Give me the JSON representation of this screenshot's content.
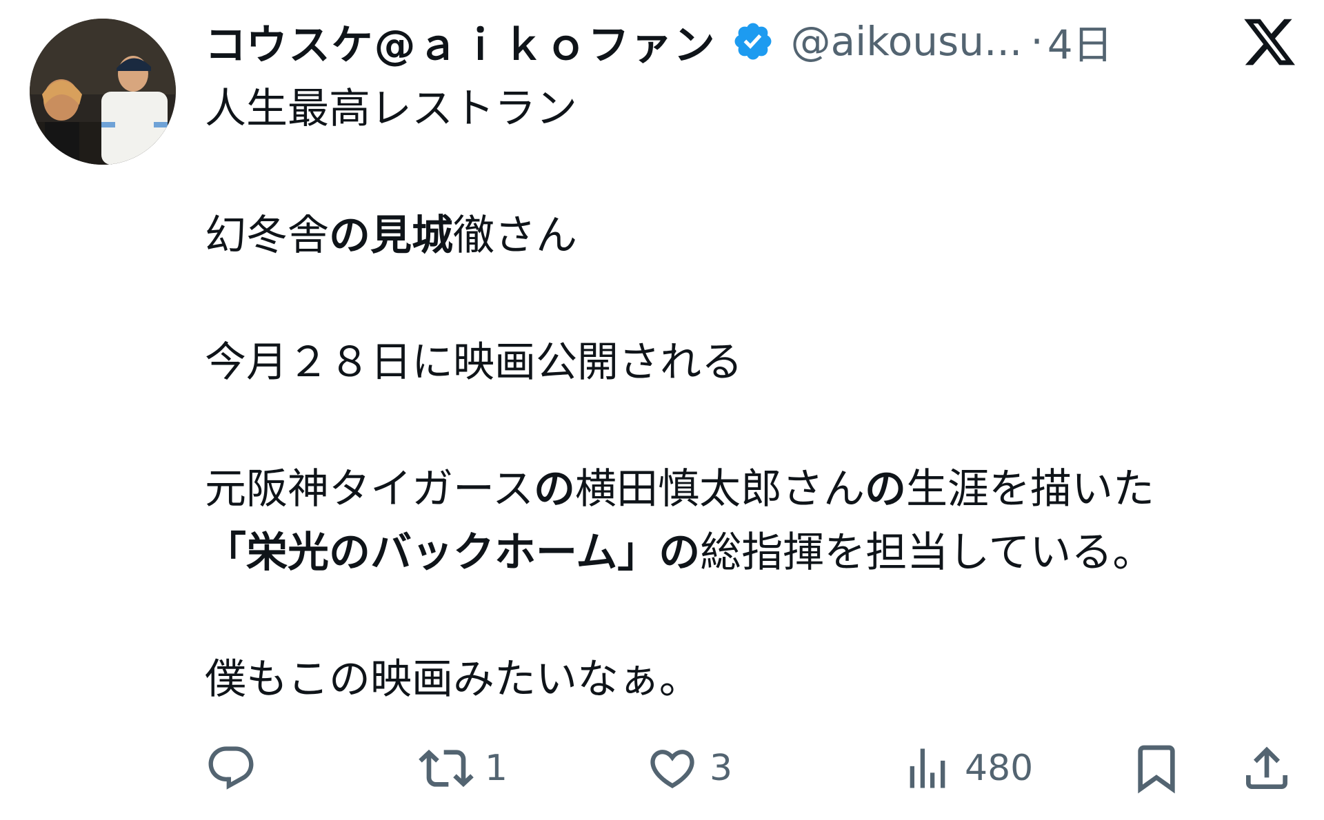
{
  "tweet": {
    "display_name": "コウスケ@ａｉｋｏファン",
    "handle": "@aikousu...",
    "separator": "·",
    "time": "4日",
    "body": {
      "line1": "人生最高レストラン",
      "line2_a": "幻冬舎",
      "line2_b": "の見城",
      "line2_c": "徹さん",
      "line3": "今月２８日に映画公開される",
      "line4_a": "元阪神タイガース",
      "line4_b": "の",
      "line4_c": "横田慎太郎さん",
      "line4_d": "の",
      "line4_e": "生涯を描いた",
      "line5_a": "「栄光のバックホーム」の",
      "line5_b": "総指揮を担当している。",
      "line6": "僕もこの映画みたいなぁ。"
    },
    "actions": {
      "retweet_count": "1",
      "like_count": "3",
      "view_count": "480"
    }
  },
  "icons": {
    "avatar": "avatar-photo",
    "verified": "verified-badge-icon",
    "logo": "x-logo-icon",
    "reply": "reply-icon",
    "retweet": "retweet-icon",
    "like": "heart-icon",
    "views": "views-icon",
    "bookmark": "bookmark-icon",
    "share": "share-icon"
  },
  "colors": {
    "text": "#0f1419",
    "secondary": "#536471",
    "verified": "#1d9bf0"
  }
}
